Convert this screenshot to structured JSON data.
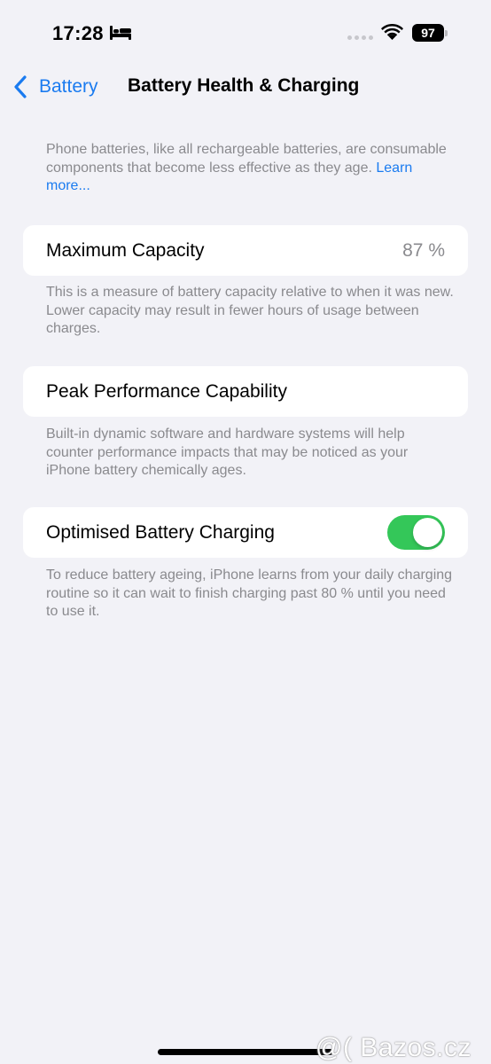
{
  "status_bar": {
    "time": "17:28",
    "battery_level": "97",
    "icons": [
      "bed-icon",
      "signal-dots-icon",
      "wifi-icon",
      "battery-icon"
    ]
  },
  "nav": {
    "back_label": "Battery",
    "title": "Battery Health & Charging"
  },
  "intro": {
    "text": "Phone batteries, like all rechargeable batteries, are consumable components that become less effective as they age. ",
    "link": "Learn more..."
  },
  "max_capacity": {
    "label": "Maximum Capacity",
    "value": "87 %",
    "footnote": "This is a measure of battery capacity relative to when it was new. Lower capacity may result in fewer hours of usage between charges."
  },
  "peak_performance": {
    "label": "Peak Performance Capability",
    "footnote": "Built-in dynamic software and hardware systems will help counter performance impacts that may be noticed as your iPhone battery chemically ages."
  },
  "optimised_charging": {
    "label": "Optimised Battery Charging",
    "enabled": true,
    "footnote": "To reduce battery ageing, iPhone learns from your daily charging routine so it can wait to finish charging past 80 % until you need to use it."
  },
  "watermark": "@( Bazos.cz",
  "colors": {
    "accent": "#1a7bf0",
    "toggle_on": "#34c759",
    "background": "#f2f2f7",
    "secondary_text": "#8a8a8e"
  }
}
